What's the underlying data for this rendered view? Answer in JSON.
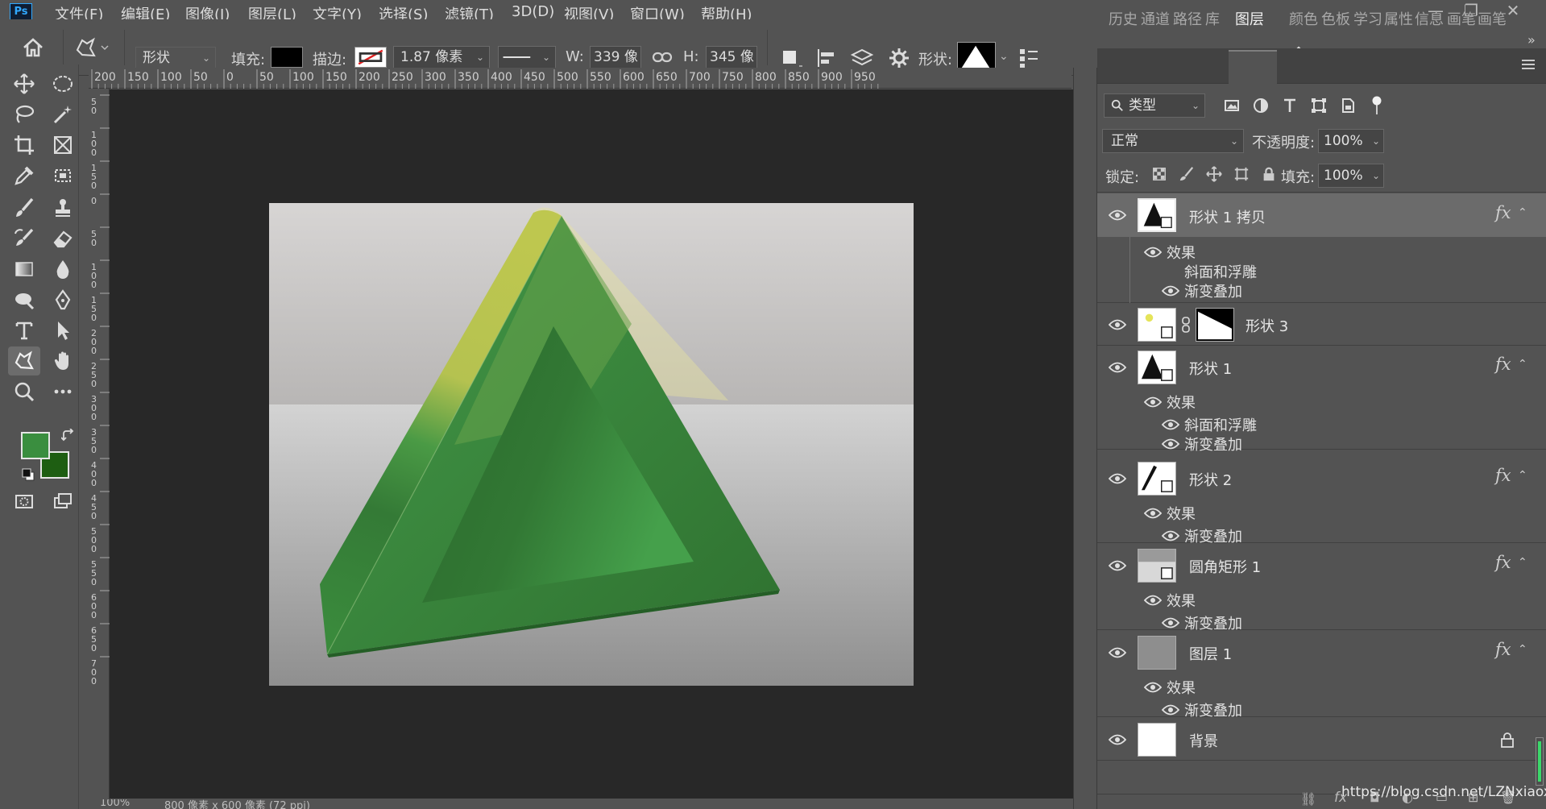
{
  "app": {
    "logo": "Ps"
  },
  "menu": {
    "items": [
      "文件(F)",
      "编辑(E)",
      "图像(I)",
      "图层(L)",
      "文字(Y)",
      "选择(S)",
      "滤镜(T)",
      "3D(D)",
      "视图(V)",
      "窗口(W)",
      "帮助(H)"
    ]
  },
  "window_controls": {
    "minimize": "—",
    "restore": "❐",
    "close": "✕"
  },
  "options_bar": {
    "mode": "形状",
    "fill_label": "填充:",
    "stroke_label": "描边:",
    "stroke_width": "1.87 像素",
    "w_label": "W:",
    "w_value": "339 像素",
    "h_label": "H:",
    "h_value": "345 像素",
    "shape_label": "形状:",
    "fill_color": "#000000",
    "expand": "»"
  },
  "rulers": {
    "h_ticks": [
      "200",
      "150",
      "100",
      "50",
      "0",
      "50",
      "100",
      "150",
      "200",
      "250",
      "300",
      "350",
      "400",
      "450",
      "500",
      "550",
      "600",
      "650",
      "700",
      "750",
      "800",
      "850",
      "900",
      "950"
    ],
    "v_ticks": [
      "50",
      "100",
      "150",
      "0",
      "50",
      "100",
      "150",
      "200",
      "250",
      "300",
      "350",
      "400",
      "450",
      "500",
      "550",
      "600",
      "650",
      "700"
    ]
  },
  "colors": {
    "foreground": "#3a8e3f",
    "background": "#1e5e12",
    "accent": "#31a8ff"
  },
  "panel_tabs": [
    "历史",
    "通道",
    "路径",
    "库",
    "图层",
    "颜色",
    "色板",
    "学习",
    "属性",
    "信息",
    "画笔",
    "画笔"
  ],
  "active_tab": "图层",
  "layers_panel": {
    "filter_label": "类型",
    "blend_mode": "正常",
    "opacity_label": "不透明度:",
    "opacity_value": "100%",
    "lock_label": "锁定:",
    "fill_label": "填充:",
    "fill_value": "100%"
  },
  "layers": [
    {
      "name": "形状 1 拷贝",
      "fx": "fx",
      "effects_label": "效果",
      "effects": [
        "斜面和浮雕",
        "渐变叠加"
      ]
    },
    {
      "name": "形状 3"
    },
    {
      "name": "形状 1",
      "fx": "fx",
      "effects_label": "效果",
      "effects": [
        "斜面和浮雕",
        "渐变叠加"
      ]
    },
    {
      "name": "形状 2",
      "fx": "fx",
      "effects_label": "效果",
      "effects": [
        "渐变叠加"
      ]
    },
    {
      "name": "圆角矩形 1",
      "fx": "fx",
      "effects_label": "效果",
      "effects": [
        "渐变叠加"
      ]
    },
    {
      "name": "图层 1",
      "fx": "fx",
      "effects_label": "效果",
      "effects": [
        "渐变叠加"
      ]
    },
    {
      "name": "背景"
    }
  ],
  "status": {
    "zoom": "100%",
    "doc_info": "800 像素 x 600 像素 (72 ppi)"
  },
  "watermark": "https://blog.csdn.net/LZNxiaoxiang"
}
